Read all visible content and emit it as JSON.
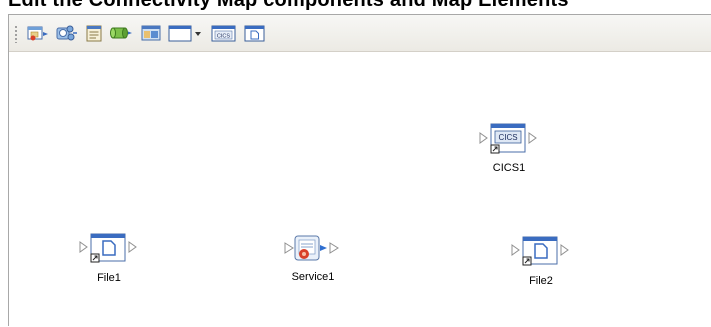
{
  "header": {
    "title_fragment": "Edit the Connectivity Map components and Map Elements"
  },
  "toolbar": {
    "buttons": [
      {
        "name": "add-file-button",
        "icon": "file-component-icon"
      },
      {
        "name": "add-service-button",
        "icon": "service-component-icon"
      },
      {
        "name": "add-web-service-button",
        "icon": "web-service-icon"
      },
      {
        "name": "add-queue-button",
        "icon": "queue-icon"
      },
      {
        "name": "add-collaboration-button",
        "icon": "collaboration-icon"
      },
      {
        "name": "add-external-application-dropdown",
        "icon": "external-application-dropdown-icon"
      },
      {
        "name": "add-cics-button",
        "icon": "cics-icon",
        "label": "CICS"
      },
      {
        "name": "add-file-external-button",
        "icon": "file-icon"
      }
    ]
  },
  "canvas": {
    "nodes": [
      {
        "id": "cics1",
        "label": "CICS1",
        "icon_text": "CICS",
        "type": "cics-external"
      },
      {
        "id": "file1",
        "label": "File1",
        "type": "file-external"
      },
      {
        "id": "service1",
        "label": "Service1",
        "type": "service"
      },
      {
        "id": "file2",
        "label": "File2",
        "type": "file-external"
      }
    ]
  },
  "colors": {
    "accent_blue": "#2f6fd0",
    "window_blue": "#6fa0d8",
    "connector_gray": "#b0b0b0",
    "service_red": "#d8402a"
  }
}
